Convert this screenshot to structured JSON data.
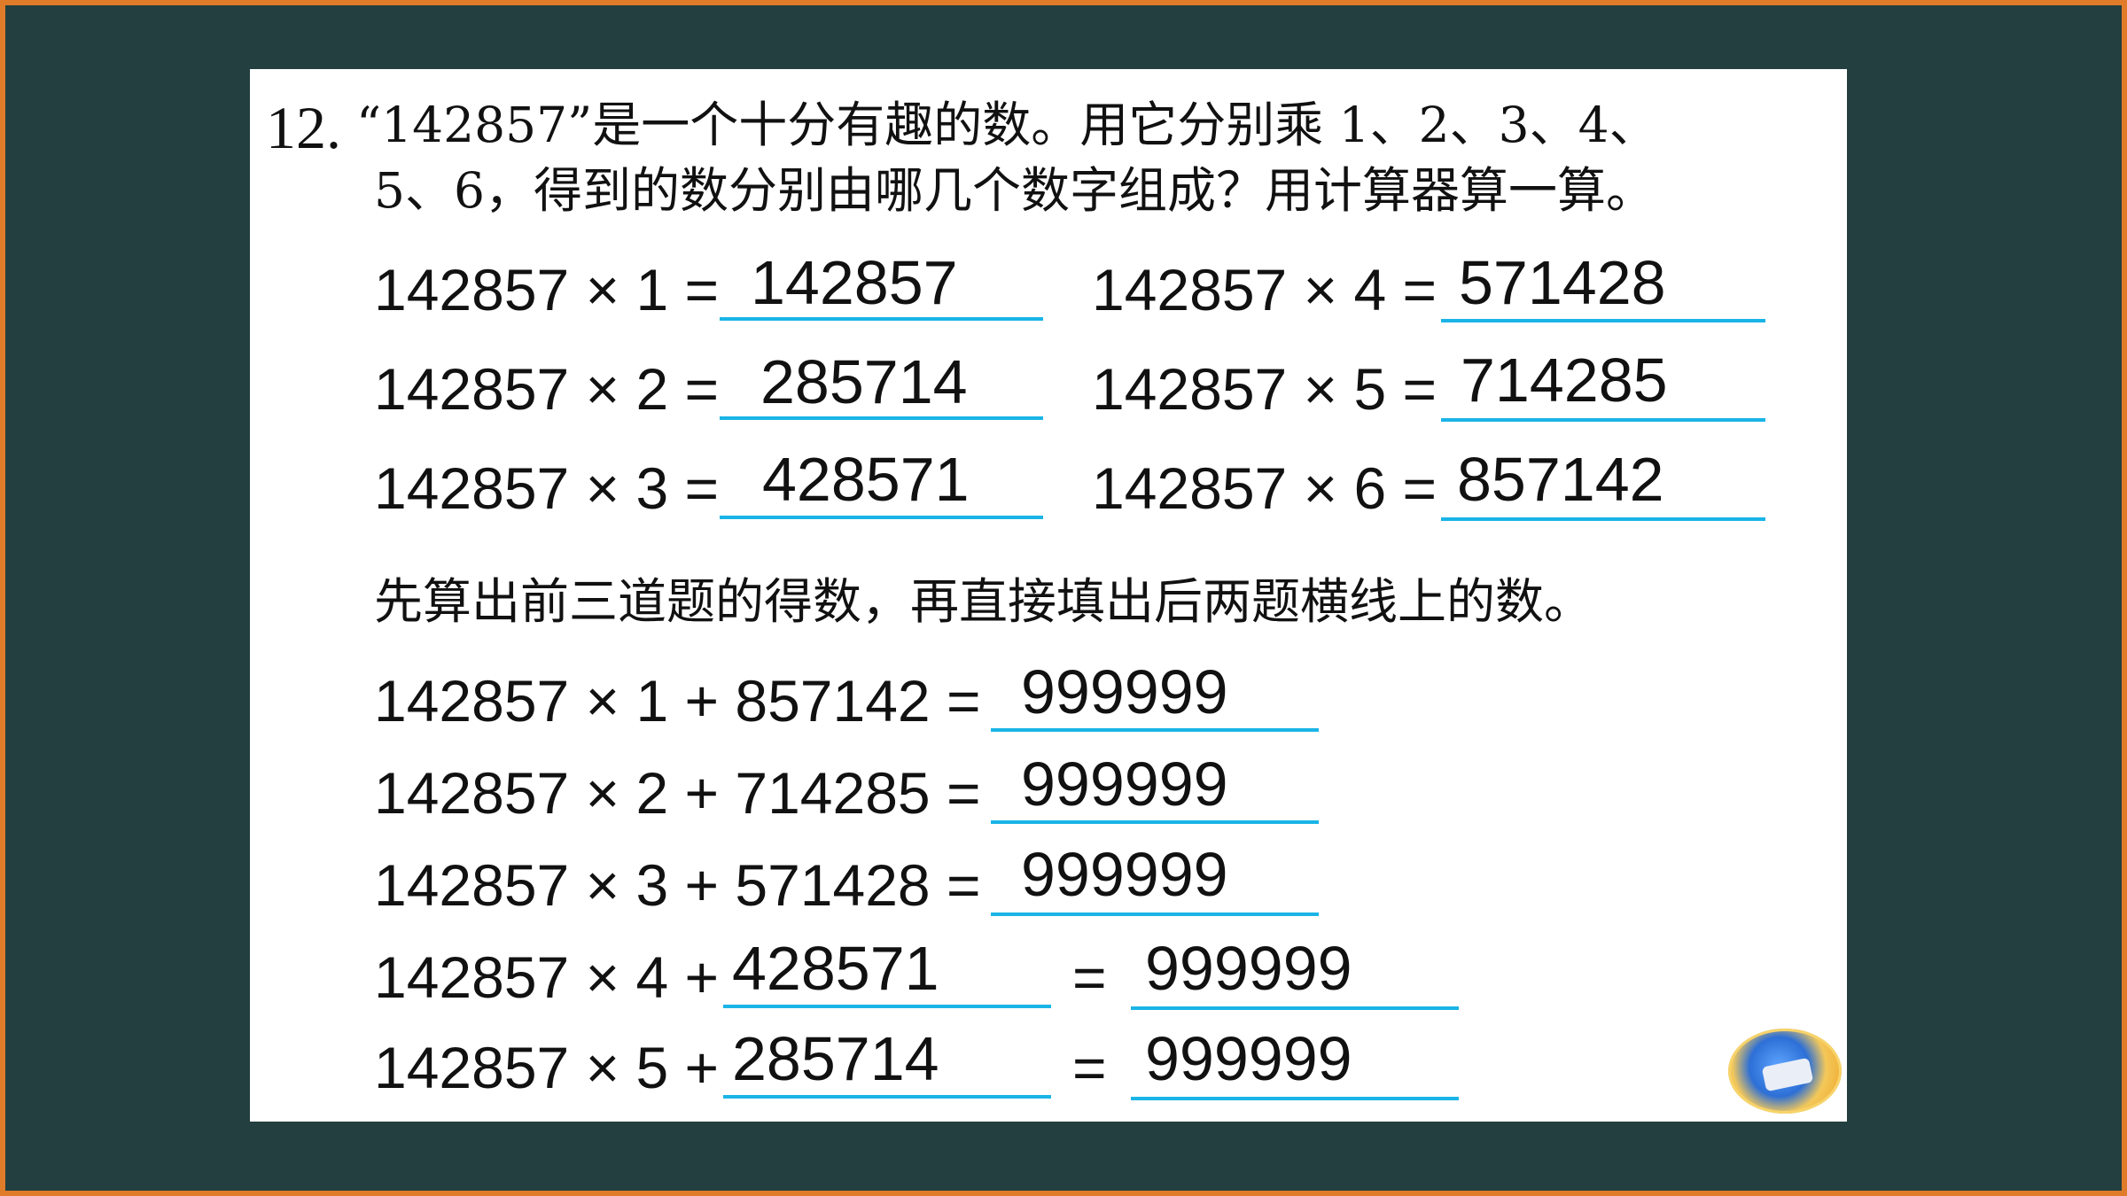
{
  "problem": {
    "number": "12.",
    "line1": "“142857”是一个十分有趣的数。用它分别乘 1、2、3、4、",
    "line2": "5、6，得到的数分别由哪几个数字组成？用计算器算一算。"
  },
  "part1": [
    {
      "expr": "142857 × 1 =",
      "answer": "142857"
    },
    {
      "expr": "142857 × 2 =",
      "answer": "285714"
    },
    {
      "expr": "142857 × 3 =",
      "answer": "428571"
    },
    {
      "expr": "142857 × 4 =",
      "answer": "571428"
    },
    {
      "expr": "142857 × 5 =",
      "answer": "714285"
    },
    {
      "expr": "142857 × 6 =",
      "answer": "857142"
    }
  ],
  "instruction": "先算出前三道题的得数，再直接填出后两题横线上的数。",
  "part2": [
    {
      "expr": "142857 × 1 + 857142 =",
      "answer": "999999"
    },
    {
      "expr": "142857 × 2 + 714285 =",
      "answer": "999999"
    },
    {
      "expr": "142857 × 3 + 571428 =",
      "answer": "999999"
    },
    {
      "expr": "142857 × 4 +",
      "fill": "428571",
      "eq": "=",
      "answer": "999999"
    },
    {
      "expr": "142857 × 5 +",
      "fill": "285714",
      "eq": "=",
      "answer": "999999"
    }
  ],
  "colors": {
    "background": "#233f3f",
    "border": "#e07b2a",
    "underline": "#1ab4e6"
  },
  "icons": {
    "badge": "book-badge-icon"
  }
}
